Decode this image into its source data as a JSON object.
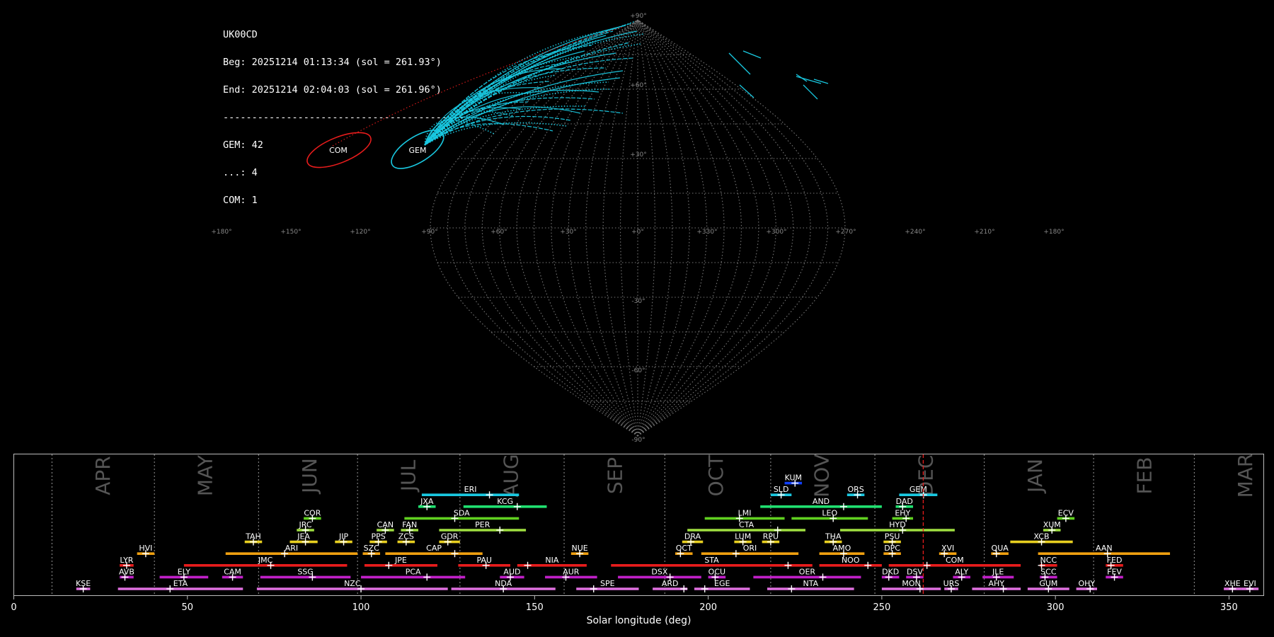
{
  "station_info": {
    "camera": "UK00CD",
    "begin": "Beg: 20251214 01:13:34 (sol = 261.93°)",
    "end": "End: 20251214 02:04:03 (sol = 261.96°)",
    "separator": "------------------------------------------",
    "counts": [
      "GEM: 42",
      "...: 4",
      "COM: 1"
    ]
  },
  "colors": {
    "background": "#000000",
    "grid": "#777777",
    "gem": "#19c8e0",
    "com": "#e81c1c",
    "current_sol_marker": "#e81c1c",
    "frame": "#bbbbbb"
  },
  "sky_map": {
    "projection": "sinusoidal",
    "lat_labels": [
      "+90°",
      "+60°",
      "+30°",
      "-30°",
      "-60°",
      "-90°"
    ],
    "lon_labels": [
      "+180°",
      "+150°",
      "+120°",
      "+90°",
      "+60°",
      "+30°",
      "+0°",
      "+330°",
      "+300°",
      "+270°",
      "+240°",
      "+210°",
      "+180°"
    ],
    "radiants": [
      {
        "code": "COM",
        "color": "#e81c1c"
      },
      {
        "code": "GEM",
        "color": "#19c8e0"
      }
    ]
  },
  "chart_data": {
    "type": "timeline",
    "xlabel": "Solar longitude (deg)",
    "xlim": [
      0,
      360
    ],
    "xticks": [
      0,
      50,
      100,
      150,
      200,
      250,
      300,
      350
    ],
    "current_sol": 261.93,
    "months": [
      {
        "label": "APR",
        "start": 11
      },
      {
        "label": "MAY",
        "start": 40.5
      },
      {
        "label": "JUN",
        "start": 70.5
      },
      {
        "label": "JUL",
        "start": 99
      },
      {
        "label": "AUG",
        "start": 128.5
      },
      {
        "label": "SEP",
        "start": 158.5
      },
      {
        "label": "OCT",
        "start": 187.5
      },
      {
        "label": "NOV",
        "start": 218
      },
      {
        "label": "DEC",
        "start": 248
      },
      {
        "label": "JAN",
        "start": 279.5
      },
      {
        "label": "FEB",
        "start": 311
      },
      {
        "label": "MAR",
        "start": 340
      }
    ],
    "showers": [
      {
        "code": "KUM",
        "row": 9,
        "start": 222,
        "end": 227,
        "peak": 225,
        "color": "#1040ff"
      },
      {
        "code": "ERI",
        "row": 8,
        "start": 117.5,
        "end": 145.5,
        "peak": 137,
        "color": "#19c8e0"
      },
      {
        "code": "SLD",
        "row": 8,
        "start": 218,
        "end": 224,
        "peak": 221,
        "color": "#19c8e0"
      },
      {
        "code": "ORS",
        "row": 8,
        "start": 240,
        "end": 245,
        "peak": 243,
        "color": "#19c8e0"
      },
      {
        "code": "GEM",
        "row": 8,
        "start": 255,
        "end": 266,
        "peak": 262,
        "color": "#19c8e0"
      },
      {
        "code": "JXA",
        "row": 7,
        "start": 116.5,
        "end": 121.5,
        "peak": 119,
        "color": "#20e070"
      },
      {
        "code": "KCG",
        "row": 7,
        "start": 129.5,
        "end": 153.5,
        "peak": 145,
        "color": "#20e070"
      },
      {
        "code": "AND",
        "row": 7,
        "start": 215,
        "end": 250,
        "peak": 239,
        "color": "#20e070"
      },
      {
        "code": "DAD",
        "row": 7,
        "start": 254,
        "end": 259,
        "peak": 256,
        "color": "#20e070"
      },
      {
        "code": "COR",
        "row": 6,
        "start": 83.5,
        "end": 88.5,
        "peak": 86,
        "color": "#60d020"
      },
      {
        "code": "SDA",
        "row": 6,
        "start": 112.5,
        "end": 145.5,
        "peak": 127,
        "color": "#60d020"
      },
      {
        "code": "LMI",
        "row": 6,
        "start": 199,
        "end": 222,
        "peak": 209,
        "color": "#60d020"
      },
      {
        "code": "LEO",
        "row": 6,
        "start": 224,
        "end": 246,
        "peak": 236,
        "color": "#60d020"
      },
      {
        "code": "EHY",
        "row": 6,
        "start": 253,
        "end": 259,
        "peak": 257,
        "color": "#60d020"
      },
      {
        "code": "ECV",
        "row": 6,
        "start": 300.5,
        "end": 305.5,
        "peak": 303,
        "color": "#60d020"
      },
      {
        "code": "JRC",
        "row": 5,
        "start": 81.5,
        "end": 86.5,
        "peak": 84,
        "color": "#a0e040"
      },
      {
        "code": "CAN",
        "row": 5,
        "start": 104.5,
        "end": 109.5,
        "peak": 107,
        "color": "#a0e040"
      },
      {
        "code": "FAN",
        "row": 5,
        "start": 111.5,
        "end": 116.5,
        "peak": 114,
        "color": "#a0e040"
      },
      {
        "code": "PER",
        "row": 5,
        "start": 122.5,
        "end": 147.5,
        "peak": 140,
        "color": "#a0e040"
      },
      {
        "code": "CTA",
        "row": 5,
        "start": 194,
        "end": 228,
        "peak": 220,
        "color": "#a0e040"
      },
      {
        "code": "HYD",
        "row": 5,
        "start": 238,
        "end": 271,
        "peak": 256,
        "color": "#a0e040"
      },
      {
        "code": "XUM",
        "row": 5,
        "start": 296.5,
        "end": 301.5,
        "peak": 299,
        "color": "#a0e040"
      },
      {
        "code": "TAH",
        "row": 4,
        "start": 66.5,
        "end": 71.5,
        "peak": 69,
        "color": "#e8d020"
      },
      {
        "code": "JEA",
        "row": 4,
        "start": 79.5,
        "end": 87.5,
        "peak": 84,
        "color": "#e8d020"
      },
      {
        "code": "JIP",
        "row": 4,
        "start": 92.5,
        "end": 97.5,
        "peak": 95,
        "color": "#e8d020"
      },
      {
        "code": "PPS",
        "row": 4,
        "start": 102.5,
        "end": 107.5,
        "peak": 105,
        "color": "#e8d020"
      },
      {
        "code": "ZCS",
        "row": 4,
        "start": 110.5,
        "end": 115.5,
        "peak": 113,
        "color": "#e8d020"
      },
      {
        "code": "GDR",
        "row": 4,
        "start": 122.5,
        "end": 128.5,
        "peak": 125,
        "color": "#e8d020"
      },
      {
        "code": "DRA",
        "row": 4,
        "start": 192.5,
        "end": 198.5,
        "peak": 195,
        "color": "#e8d020"
      },
      {
        "code": "LUM",
        "row": 4,
        "start": 207.5,
        "end": 212.5,
        "peak": 210,
        "color": "#e8d020"
      },
      {
        "code": "RPU",
        "row": 4,
        "start": 215.5,
        "end": 220.5,
        "peak": 218,
        "color": "#e8d020"
      },
      {
        "code": "THA",
        "row": 4,
        "start": 233.5,
        "end": 238.5,
        "peak": 236,
        "color": "#e8d020"
      },
      {
        "code": "PSU",
        "row": 4,
        "start": 250.5,
        "end": 255.5,
        "peak": 253,
        "color": "#e8d020"
      },
      {
        "code": "XCB",
        "row": 4,
        "start": 287,
        "end": 305,
        "peak": 296,
        "color": "#e8d020"
      },
      {
        "code": "HVI",
        "row": 3,
        "start": 35.5,
        "end": 40.5,
        "peak": 38,
        "color": "#f0a010"
      },
      {
        "code": "ARI",
        "row": 3,
        "start": 61,
        "end": 99,
        "peak": 78,
        "color": "#f0a010"
      },
      {
        "code": "SZC",
        "row": 3,
        "start": 100.5,
        "end": 105.5,
        "peak": 103,
        "color": "#f0a010"
      },
      {
        "code": "CAP",
        "row": 3,
        "start": 107,
        "end": 135,
        "peak": 127,
        "color": "#f0a010"
      },
      {
        "code": "NUE",
        "row": 3,
        "start": 160.5,
        "end": 165.5,
        "peak": 163,
        "color": "#f0a010"
      },
      {
        "code": "OCT",
        "row": 3,
        "start": 190.5,
        "end": 195.5,
        "peak": 192,
        "color": "#f0a010"
      },
      {
        "code": "ORI",
        "row": 3,
        "start": 198,
        "end": 226,
        "peak": 208,
        "color": "#f0a010"
      },
      {
        "code": "AMO",
        "row": 3,
        "start": 232,
        "end": 245,
        "peak": 239,
        "color": "#f0a010"
      },
      {
        "code": "DPC",
        "row": 3,
        "start": 250.5,
        "end": 255.5,
        "peak": 253,
        "color": "#f0a010"
      },
      {
        "code": "XVI",
        "row": 3,
        "start": 266.5,
        "end": 271.5,
        "peak": 268,
        "color": "#f0a010"
      },
      {
        "code": "QUA",
        "row": 3,
        "start": 281.5,
        "end": 286.5,
        "peak": 283,
        "color": "#f0a010"
      },
      {
        "code": "AAN",
        "row": 3,
        "start": 295,
        "end": 333,
        "peak": 315,
        "color": "#f0a010"
      },
      {
        "code": "LYR",
        "row": 2,
        "start": 30.5,
        "end": 34.5,
        "peak": 32.5,
        "color": "#e81c1c"
      },
      {
        "code": "JMC",
        "row": 2,
        "start": 49,
        "end": 96,
        "peak": 74,
        "color": "#e81c1c"
      },
      {
        "code": "JPE",
        "row": 2,
        "start": 101,
        "end": 122,
        "peak": 108,
        "color": "#e81c1c"
      },
      {
        "code": "PAU",
        "row": 2,
        "start": 128,
        "end": 143,
        "peak": 136,
        "color": "#e81c1c"
      },
      {
        "code": "NIA",
        "row": 2,
        "start": 145,
        "end": 165,
        "peak": 148,
        "color": "#e81c1c"
      },
      {
        "code": "STA",
        "row": 2,
        "start": 172,
        "end": 230,
        "peak": 223,
        "color": "#e81c1c"
      },
      {
        "code": "NOO",
        "row": 2,
        "start": 232,
        "end": 250,
        "peak": 246,
        "color": "#e81c1c"
      },
      {
        "code": "COM",
        "row": 2,
        "start": 252,
        "end": 290,
        "peak": 263,
        "color": "#e81c1c"
      },
      {
        "code": "NCC",
        "row": 2,
        "start": 295.5,
        "end": 300.5,
        "peak": 296,
        "color": "#e81c1c"
      },
      {
        "code": "FED",
        "row": 2,
        "start": 314.5,
        "end": 319.5,
        "peak": 316,
        "color": "#e81c1c"
      },
      {
        "code": "AVB",
        "row": 1,
        "start": 30.5,
        "end": 34.5,
        "peak": 32,
        "color": "#c020c8"
      },
      {
        "code": "ELY",
        "row": 1,
        "start": 42,
        "end": 56,
        "peak": 49,
        "color": "#c020c8"
      },
      {
        "code": "CAM",
        "row": 1,
        "start": 60,
        "end": 66,
        "peak": 63,
        "color": "#c020c8"
      },
      {
        "code": "SSG",
        "row": 1,
        "start": 71,
        "end": 97,
        "peak": 86,
        "color": "#c020c8"
      },
      {
        "code": "PCA",
        "row": 1,
        "start": 100,
        "end": 130,
        "peak": 119,
        "color": "#c020c8"
      },
      {
        "code": "AUD",
        "row": 1,
        "start": 140,
        "end": 147,
        "peak": 143,
        "color": "#c020c8"
      },
      {
        "code": "AUR",
        "row": 1,
        "start": 153,
        "end": 168,
        "peak": 159,
        "color": "#c020c8"
      },
      {
        "code": "DSX",
        "row": 1,
        "start": 174,
        "end": 198,
        "peak": 189,
        "color": "#c020c8"
      },
      {
        "code": "OCU",
        "row": 1,
        "start": 200,
        "end": 205,
        "peak": 202,
        "color": "#c020c8"
      },
      {
        "code": "OER",
        "row": 1,
        "start": 213,
        "end": 244,
        "peak": 233,
        "color": "#c020c8"
      },
      {
        "code": "DKD",
        "row": 1,
        "start": 250,
        "end": 255,
        "peak": 252,
        "color": "#c020c8"
      },
      {
        "code": "DSV",
        "row": 1,
        "start": 257,
        "end": 262,
        "peak": 260,
        "color": "#c020c8"
      },
      {
        "code": "ALY",
        "row": 1,
        "start": 270.5,
        "end": 275.5,
        "peak": 273,
        "color": "#c020c8"
      },
      {
        "code": "JLE",
        "row": 1,
        "start": 279,
        "end": 288,
        "peak": 283,
        "color": "#c020c8"
      },
      {
        "code": "SCC",
        "row": 1,
        "start": 295.5,
        "end": 300.5,
        "peak": 297,
        "color": "#c020c8"
      },
      {
        "code": "FEV",
        "row": 1,
        "start": 314.5,
        "end": 319.5,
        "peak": 317,
        "color": "#c020c8"
      },
      {
        "code": "KSE",
        "row": 0,
        "start": 18,
        "end": 22,
        "peak": 20,
        "color": "#e070e0"
      },
      {
        "code": "ETA",
        "row": 0,
        "start": 30,
        "end": 66,
        "peak": 45,
        "color": "#e070e0"
      },
      {
        "code": "NZC",
        "row": 0,
        "start": 70,
        "end": 125,
        "peak": 100,
        "color": "#e070e0"
      },
      {
        "code": "NDA",
        "row": 0,
        "start": 126,
        "end": 156,
        "peak": 141,
        "color": "#e070e0"
      },
      {
        "code": "SPE",
        "row": 0,
        "start": 162,
        "end": 180,
        "peak": 167,
        "color": "#e070e0"
      },
      {
        "code": "ARD",
        "row": 0,
        "start": 184,
        "end": 194,
        "peak": 193,
        "color": "#e070e0"
      },
      {
        "code": "EGE",
        "row": 0,
        "start": 196,
        "end": 212,
        "peak": 199,
        "color": "#e070e0"
      },
      {
        "code": "NTA",
        "row": 0,
        "start": 217,
        "end": 242,
        "peak": 224,
        "color": "#e070e0"
      },
      {
        "code": "MON",
        "row": 0,
        "start": 250,
        "end": 267,
        "peak": 261,
        "color": "#e070e0"
      },
      {
        "code": "URS",
        "row": 0,
        "start": 268,
        "end": 272,
        "peak": 270,
        "color": "#e070e0"
      },
      {
        "code": "AHY",
        "row": 0,
        "start": 276,
        "end": 290,
        "peak": 285,
        "color": "#e070e0"
      },
      {
        "code": "GUM",
        "row": 0,
        "start": 292,
        "end": 304,
        "peak": 298,
        "color": "#e070e0"
      },
      {
        "code": "OHY",
        "row": 0,
        "start": 306,
        "end": 312,
        "peak": 310,
        "color": "#e070e0"
      },
      {
        "code": "XHE",
        "row": 0,
        "start": 348.5,
        "end": 353.5,
        "peak": 351,
        "color": "#e070e0"
      },
      {
        "code": "EVI",
        "row": 0,
        "start": 353.5,
        "end": 358.5,
        "peak": 356,
        "color": "#e070e0"
      }
    ]
  }
}
